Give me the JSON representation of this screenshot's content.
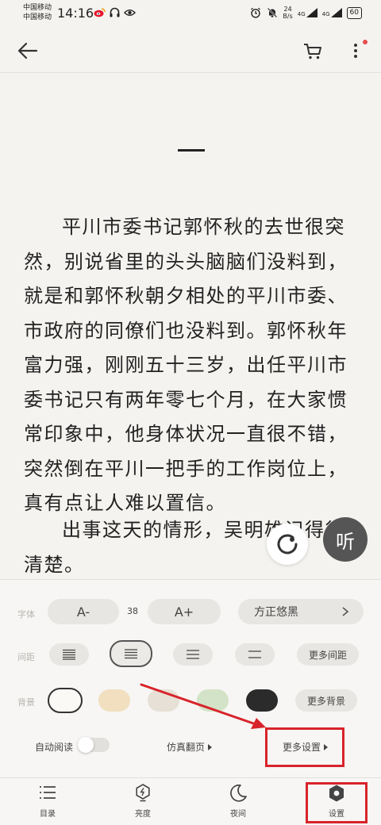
{
  "status_bar": {
    "carrier1": "中国移动",
    "carrier2": "中国移动",
    "time": "14:16",
    "net_speed_value": "24",
    "net_speed_unit": "B/s",
    "signal1": "4G",
    "signal2": "4G",
    "battery": "60"
  },
  "header": {
    "back_icon": "arrow-left-icon",
    "cart_icon": "cart-icon",
    "more_icon": "more-vertical-icon",
    "notification_color": "#e34d4d"
  },
  "content": {
    "paragraph1": "平川市委书记郭怀秋的去世很突然，别说省里的头头脑脑们没料到，就是和郭怀秋朝夕相处的平川市委、市政府的同僚们也没料到。郭怀秋年富力强，刚刚五十三岁，出任平川市委书记只有两年零七个月，在大家惯常印象中，他身体状况一直很不错，突然倒在平川一把手的工作岗位上，真有点让人难以置信。",
    "paragraph2": "出事这天的情形，吴明雄记得很清楚。",
    "listen_label": "听"
  },
  "settings": {
    "font_label": "字体",
    "font_decrease": "A-",
    "font_size": "38",
    "font_increase": "A+",
    "font_name": "方正悠黑",
    "spacing_label": "间距",
    "more_spacing": "更多间距",
    "background_label": "背景",
    "more_background": "更多背景",
    "backgrounds": [
      "#faf9f6",
      "#f1dfbf",
      "#e6e0d6",
      "#d3e3c7",
      "#2b2b2b"
    ],
    "auto_read_label": "自动阅读",
    "auto_read_on": false,
    "page_turn": "仿真翻页",
    "more_settings": "更多设置"
  },
  "bottom_nav": {
    "items": [
      {
        "label": "目录",
        "icon": "menu-list-icon"
      },
      {
        "label": "亮度",
        "icon": "brightness-icon"
      },
      {
        "label": "夜间",
        "icon": "moon-icon"
      },
      {
        "label": "设置",
        "icon": "settings-icon"
      }
    ]
  },
  "annotation_color": "#d8232a"
}
